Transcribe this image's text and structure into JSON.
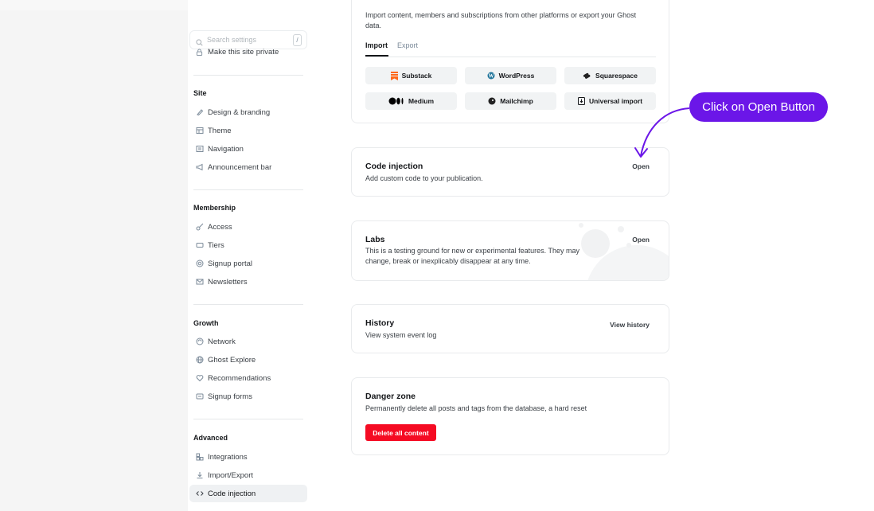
{
  "sidebar": {
    "search": {
      "placeholder": "Search settings",
      "shortcut": "/"
    },
    "top_item": {
      "label": "Make this site private",
      "icon": "lock-icon"
    },
    "sections": [
      {
        "heading": "Site",
        "items": [
          {
            "label": "Design & branding",
            "icon": "brush-icon"
          },
          {
            "label": "Theme",
            "icon": "layout-icon"
          },
          {
            "label": "Navigation",
            "icon": "navigation-icon"
          },
          {
            "label": "Announcement bar",
            "icon": "megaphone-icon"
          }
        ]
      },
      {
        "heading": "Membership",
        "items": [
          {
            "label": "Access",
            "icon": "key-icon"
          },
          {
            "label": "Tiers",
            "icon": "ticket-icon"
          },
          {
            "label": "Signup portal",
            "icon": "portal-icon"
          },
          {
            "label": "Newsletters",
            "icon": "mail-icon"
          }
        ]
      },
      {
        "heading": "Growth",
        "items": [
          {
            "label": "Network",
            "icon": "network-icon"
          },
          {
            "label": "Ghost Explore",
            "icon": "globe-icon"
          },
          {
            "label": "Recommendations",
            "icon": "heart-icon"
          },
          {
            "label": "Signup forms",
            "icon": "form-icon"
          }
        ]
      },
      {
        "heading": "Advanced",
        "items": [
          {
            "label": "Integrations",
            "icon": "integrations-icon"
          },
          {
            "label": "Import/Export",
            "icon": "download-icon"
          },
          {
            "label": "Code injection",
            "icon": "code-icon",
            "active": true
          }
        ]
      }
    ]
  },
  "migration_card": {
    "description": "Import content, members and subscriptions from other platforms or export your Ghost data.",
    "tabs": [
      "Import",
      "Export"
    ],
    "active_tab": "Import",
    "buttons": [
      {
        "label": "Substack",
        "icon": "substack-icon"
      },
      {
        "label": "WordPress",
        "icon": "wordpress-icon"
      },
      {
        "label": "Squarespace",
        "icon": "squarespace-icon"
      },
      {
        "label": "Medium",
        "icon": "medium-icon"
      },
      {
        "label": "Mailchimp",
        "icon": "mailchimp-icon"
      },
      {
        "label": "Universal import",
        "icon": "universal-import-icon"
      }
    ]
  },
  "code_injection_card": {
    "title": "Code injection",
    "description": "Add custom code to your publication.",
    "action": "Open"
  },
  "labs_card": {
    "title": "Labs",
    "description": "This is a testing ground for new or experimental features. They may change, break or inexplicably disappear at any time.",
    "action": "Open"
  },
  "history_card": {
    "title": "History",
    "description": "View system event log",
    "action": "View history"
  },
  "danger_card": {
    "title": "Danger zone",
    "description": "Permanently delete all posts and tags from the database, a hard reset",
    "button": "Delete all content"
  },
  "annotation": {
    "text": "Click on Open Button"
  },
  "colors": {
    "accent": "#6b16e8",
    "danger": "#f50b23",
    "active_bg": "#eff1f3"
  }
}
